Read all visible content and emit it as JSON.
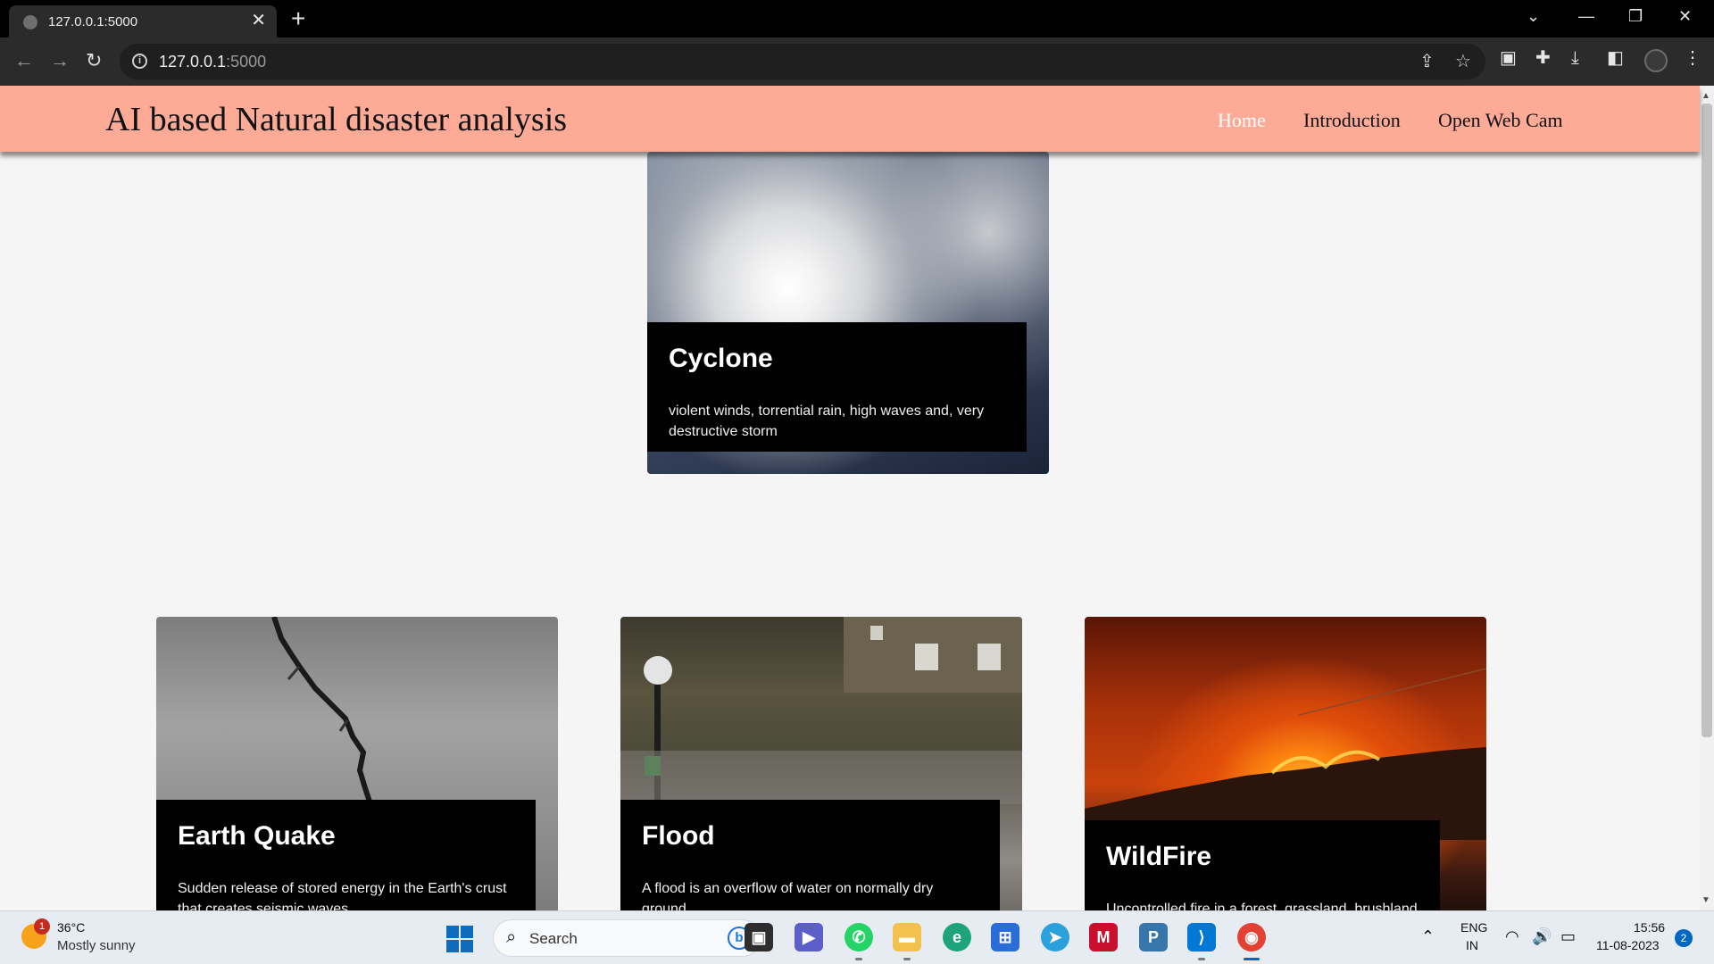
{
  "browser": {
    "tab_title": "127.0.0.1:5000",
    "url_host": "127.0.0.1",
    "url_port": ":5000"
  },
  "navbar": {
    "brand": "AI based Natural disaster analysis",
    "links": [
      "Home",
      "Introduction",
      "Open Web Cam"
    ],
    "active_link": "Home",
    "bg_color": "#fdab97"
  },
  "cards": [
    {
      "title": "Cyclone",
      "text": "violent winds, torrential rain, high waves and, very destructive storm"
    },
    {
      "title": "Earth Quake",
      "text": "Sudden release of stored energy in the Earth's crust that creates seismic waves."
    },
    {
      "title": "Flood",
      "text": "A flood is an overflow of water on normally dry ground"
    },
    {
      "title": "WildFire",
      "text": "Uncontrolled fire in a forest, grassland, brushland"
    }
  ],
  "taskbar": {
    "weather_badge": "1",
    "weather_temp": "36°C",
    "weather_desc": "Mostly sunny",
    "search_label": "Search",
    "lang_line1": "ENG",
    "lang_line2": "IN",
    "time": "15:56",
    "date": "11-08-2023",
    "notifications": "2"
  }
}
